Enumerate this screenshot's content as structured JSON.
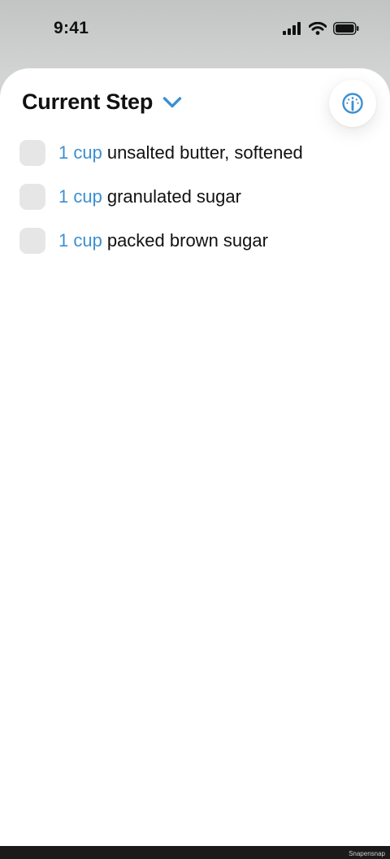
{
  "status_bar": {
    "time": "9:41",
    "icons": [
      "cellular-signal-icon",
      "wifi-icon",
      "battery-icon"
    ]
  },
  "sheet": {
    "title": "Current Step",
    "chevron_icon": "chevron-down-icon",
    "info_icon": "gauge-info-icon"
  },
  "ingredients": [
    {
      "quantity": "1 cup",
      "name": "unsalted butter, softened",
      "checked": false
    },
    {
      "quantity": "1 cup",
      "name": "granulated sugar",
      "checked": false
    },
    {
      "quantity": "1 cup",
      "name": "packed brown sugar",
      "checked": false
    }
  ],
  "colors": {
    "accent": "#3d8fd1",
    "checkbox": "#e6e6e6"
  },
  "watermark": "Snapensnap"
}
